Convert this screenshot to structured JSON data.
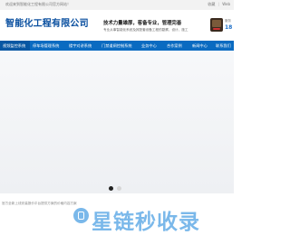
{
  "topbar": {
    "welcome": "欢迎来到智能化工程有限公司官方网站！",
    "links": [
      "收藏",
      "|",
      "Web"
    ]
  },
  "header": {
    "company": "智能化工程有限公司",
    "slogan": "技术力量雄厚，客备专业，管理完善",
    "slogan_sub": "专业从事智能化系统及其配套设备工程的勘察、设计、施工",
    "hotline_label": "服务",
    "hotline_number": "18"
  },
  "nav": {
    "items": [
      {
        "label": "视频监控系统"
      },
      {
        "label": "停车场管理系统"
      },
      {
        "label": "楼宇对讲系统"
      },
      {
        "label": "门禁道闸控制系统"
      },
      {
        "label": "业务中心"
      },
      {
        "label": "合作案例"
      },
      {
        "label": "新闻中心"
      },
      {
        "label": "联系我们"
      }
    ]
  },
  "banner": {
    "dot_count": 2,
    "active_dot": 0
  },
  "notice": {
    "text": "官方全新上线安装报价平台提供方案的价格内容方案"
  },
  "watermark": {
    "text": "星链秒收录"
  },
  "colors": {
    "brand": "#0a6bc1",
    "brand_dark": "#0857a3",
    "logo": "#0a50a0",
    "watermark": "#7ab8ea"
  }
}
